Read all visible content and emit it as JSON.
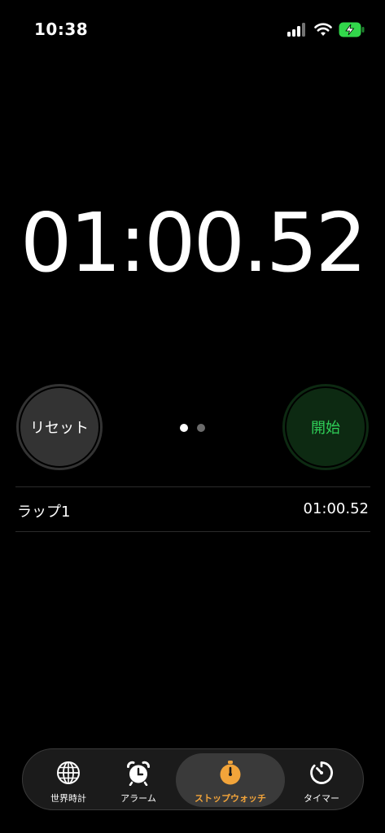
{
  "status_bar": {
    "time": "10:38",
    "icons": [
      "cellular-signal-icon",
      "wifi-icon",
      "battery-charging-icon"
    ],
    "battery_color": "#32d74b"
  },
  "stopwatch": {
    "display": "01:00.52",
    "reset_label": "リセット",
    "start_label": "開始",
    "start_color": "#2fd158",
    "page_indicator": {
      "count": 2,
      "active_index": 0
    }
  },
  "laps": [
    {
      "name": "ラップ1",
      "time": "01:00.52"
    }
  ],
  "tab_bar": {
    "tabs": [
      {
        "label": "世界時計",
        "icon": "globe-icon",
        "selected": false
      },
      {
        "label": "アラーム",
        "icon": "alarm-clock-icon",
        "selected": false
      },
      {
        "label": "ストップウォッチ",
        "icon": "stopwatch-icon",
        "selected": true
      },
      {
        "label": "タイマー",
        "icon": "timer-icon",
        "selected": false
      }
    ],
    "accent_color": "#f2a43a"
  }
}
